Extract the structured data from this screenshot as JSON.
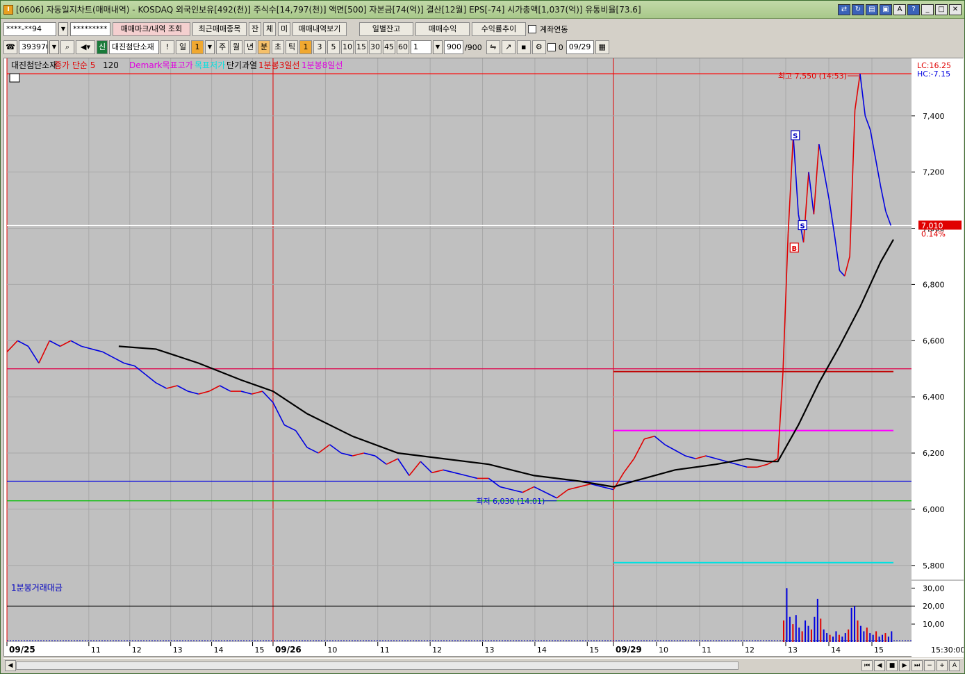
{
  "window": {
    "title": "[0606] 자동일지차트(매매내역) - KOSDAQ 외국인보유[492(천)] 주식수[14,797(천)] 액면[500] 자본금[74(억)] 결산[12월] EPS[-74] 시가총액[1,037(억)] 유통비율[73.6]"
  },
  "toolbar1": {
    "account": "****-**94",
    "password": "*********",
    "trade_mark_button": "매매마크/내역 조회",
    "recent_button": "최근매매종목",
    "jan_button": "잔",
    "che_button": "체",
    "mi_button": "미",
    "history_button": "매매내역보기",
    "daily_balance_button": "일별잔고",
    "profit_button": "매매수익",
    "return_button": "수익률추이",
    "link_label": "계좌연동"
  },
  "toolbar2": {
    "code": "393970",
    "new_badge": "신",
    "stock_name": "대진첨단소재",
    "exclaim": "!",
    "period_day": "일",
    "period_day_value": "1",
    "period_week": "주",
    "period_month": "월",
    "period_year": "년",
    "period_min": "분",
    "period_sec": "초",
    "period_tick": "틱",
    "intervals": [
      "1",
      "3",
      "5",
      "10",
      "15",
      "30",
      "45",
      "60"
    ],
    "interval_value": "1",
    "count_value": "900",
    "count_total": "/900",
    "date_value": "09/29",
    "checkbox_label": "0"
  },
  "legend": [
    {
      "text": "대진첨단소재",
      "color": "#000000"
    },
    {
      "text": "종가 단순 5",
      "color": "#e00000"
    },
    {
      "text": "120",
      "color": "#000000"
    },
    {
      "text": "Demark목표고가",
      "color": "#e000e0"
    },
    {
      "text": "목표저가",
      "color": "#00e0e0"
    },
    {
      "text": "단기과열",
      "color": "#000000"
    },
    {
      "text": "1분봉3일선",
      "color": "#e00000"
    },
    {
      "text": "1분봉8일선",
      "color": "#e000e0"
    }
  ],
  "lc_label": "LC:16.25",
  "hc_label": "HC:-7.15",
  "current_price_label": "7,010",
  "current_pct_label": "0.14%",
  "high_annotation": "최고 7,550 (14:53)",
  "low_annotation": "최저 6,030 (14:01)",
  "volume_label": "1분봉거래대금",
  "marks": {
    "s1": "S",
    "s2": "S",
    "b1": "B"
  },
  "time_end_label": "15:30:00",
  "colors": {
    "plot_bg": "#c0c0c0",
    "up": "#e00000",
    "down": "#0000e0",
    "ma120": "#000000",
    "hline_red": "#ff0000",
    "hline_crimson": "#e0004a",
    "hline_blue": "#0000e0",
    "hline_green": "#00c000",
    "hline_magenta": "#ff00ff",
    "hline_cyan": "#00e0e0"
  },
  "chart_data": {
    "type": "line",
    "title": "",
    "subtitle": "",
    "xlabel": "",
    "ylabel": "",
    "ylim": [
      5750,
      7580
    ],
    "y_ticks": [
      5800,
      6000,
      6200,
      6400,
      6600,
      6800,
      7000,
      7200,
      7400
    ],
    "y_tick_labels": [
      "5,800",
      "6,000",
      "6,200",
      "6,400",
      "6,600",
      "6,800",
      "7,000",
      "7,200",
      "7,400"
    ],
    "x_tick_labels": [
      {
        "label": "09/25",
        "day": 0,
        "hour": 9
      },
      {
        "label": "11",
        "day": 0,
        "hour": 11
      },
      {
        "label": "12",
        "day": 0,
        "hour": 12
      },
      {
        "label": "13",
        "day": 0,
        "hour": 13
      },
      {
        "label": "14",
        "day": 0,
        "hour": 14
      },
      {
        "label": "15",
        "day": 0,
        "hour": 15
      },
      {
        "label": "09/26",
        "day": 1,
        "hour": 9
      },
      {
        "label": "10",
        "day": 1,
        "hour": 10
      },
      {
        "label": "11",
        "day": 1,
        "hour": 11
      },
      {
        "label": "12",
        "day": 1,
        "hour": 12
      },
      {
        "label": "13",
        "day": 1,
        "hour": 13
      },
      {
        "label": "14",
        "day": 1,
        "hour": 14
      },
      {
        "label": "15",
        "day": 1,
        "hour": 15
      },
      {
        "label": "09/29",
        "day": 2,
        "hour": 9
      },
      {
        "label": "10",
        "day": 2,
        "hour": 10
      },
      {
        "label": "11",
        "day": 2,
        "hour": 11
      },
      {
        "label": "12",
        "day": 2,
        "hour": 12
      },
      {
        "label": "13",
        "day": 2,
        "hour": 13
      },
      {
        "label": "14",
        "day": 2,
        "hour": 14
      },
      {
        "label": "15",
        "day": 2,
        "hour": 15
      }
    ],
    "price_series": {
      "name": "대진첨단소재",
      "points": [
        [
          0,
          6560
        ],
        [
          0.02,
          6600
        ],
        [
          0.04,
          6580
        ],
        [
          0.06,
          6520
        ],
        [
          0.08,
          6600
        ],
        [
          0.1,
          6580
        ],
        [
          0.12,
          6600
        ],
        [
          0.14,
          6580
        ],
        [
          0.16,
          6570
        ],
        [
          0.18,
          6560
        ],
        [
          0.2,
          6540
        ],
        [
          0.22,
          6520
        ],
        [
          0.24,
          6510
        ],
        [
          0.26,
          6480
        ],
        [
          0.28,
          6450
        ],
        [
          0.3,
          6430
        ],
        [
          0.32,
          6440
        ],
        [
          0.34,
          6420
        ],
        [
          0.36,
          6410
        ],
        [
          0.38,
          6420
        ],
        [
          0.4,
          6440
        ],
        [
          0.42,
          6420
        ],
        [
          0.44,
          6420
        ],
        [
          0.46,
          6410
        ],
        [
          0.48,
          6420
        ],
        [
          0.5,
          6380
        ],
        [
          0.52,
          6300
        ],
        [
          0.54,
          6280
        ],
        [
          0.56,
          6220
        ],
        [
          0.58,
          6200
        ],
        [
          0.6,
          6230
        ],
        [
          0.62,
          6200
        ],
        [
          0.64,
          6190
        ],
        [
          0.66,
          6200
        ],
        [
          0.68,
          6190
        ],
        [
          0.7,
          6160
        ],
        [
          0.72,
          6180
        ],
        [
          0.74,
          6120
        ],
        [
          0.76,
          6170
        ],
        [
          0.78,
          6130
        ],
        [
          0.8,
          6140
        ],
        [
          0.82,
          6130
        ],
        [
          0.84,
          6120
        ],
        [
          0.86,
          6110
        ],
        [
          0.88,
          6110
        ],
        [
          0.9,
          6080
        ],
        [
          0.92,
          6070
        ],
        [
          0.94,
          6060
        ],
        [
          0.96,
          6080
        ],
        [
          0.98,
          6060
        ],
        [
          1.0,
          6040
        ],
        [
          1.02,
          6070
        ],
        [
          1.04,
          6080
        ],
        [
          1.06,
          6090
        ],
        [
          1.08,
          6080
        ],
        [
          1.1,
          6070
        ],
        [
          1.12,
          6130
        ],
        [
          1.14,
          6180
        ],
        [
          1.16,
          6250
        ],
        [
          1.18,
          6260
        ],
        [
          1.2,
          6230
        ],
        [
          1.22,
          6210
        ],
        [
          1.24,
          6190
        ],
        [
          1.26,
          6180
        ],
        [
          1.28,
          6190
        ],
        [
          1.3,
          6180
        ],
        [
          1.32,
          6170
        ],
        [
          1.34,
          6160
        ],
        [
          1.36,
          6150
        ],
        [
          1.38,
          6150
        ],
        [
          1.4,
          6160
        ],
        [
          1.42,
          6180
        ],
        [
          1.43,
          6490
        ],
        [
          1.44,
          6980
        ],
        [
          1.45,
          7330
        ],
        [
          1.46,
          7050
        ],
        [
          1.47,
          6950
        ],
        [
          1.48,
          7200
        ],
        [
          1.49,
          7050
        ],
        [
          1.5,
          7300
        ],
        [
          1.51,
          7200
        ],
        [
          1.52,
          7100
        ],
        [
          1.53,
          6980
        ],
        [
          1.54,
          6850
        ],
        [
          1.55,
          6830
        ],
        [
          1.56,
          6900
        ],
        [
          1.57,
          7420
        ],
        [
          1.58,
          7550
        ],
        [
          1.59,
          7400
        ],
        [
          1.6,
          7350
        ],
        [
          1.61,
          7250
        ],
        [
          1.62,
          7150
        ],
        [
          1.63,
          7060
        ],
        [
          1.64,
          7010
        ]
      ]
    },
    "ma120_series": {
      "name": "120",
      "points": [
        [
          0.21,
          6580
        ],
        [
          0.28,
          6570
        ],
        [
          0.36,
          6520
        ],
        [
          0.44,
          6460
        ],
        [
          0.5,
          6420
        ],
        [
          0.56,
          6340
        ],
        [
          0.64,
          6260
        ],
        [
          0.72,
          6200
        ],
        [
          0.8,
          6180
        ],
        [
          0.88,
          6160
        ],
        [
          0.96,
          6120
        ],
        [
          1.04,
          6100
        ],
        [
          1.1,
          6080
        ],
        [
          1.16,
          6110
        ],
        [
          1.22,
          6140
        ],
        [
          1.3,
          6160
        ],
        [
          1.36,
          6180
        ],
        [
          1.4,
          6170
        ],
        [
          1.42,
          6170
        ],
        [
          1.46,
          6300
        ],
        [
          1.5,
          6450
        ],
        [
          1.54,
          6580
        ],
        [
          1.58,
          6720
        ],
        [
          1.62,
          6880
        ],
        [
          1.645,
          6960
        ]
      ]
    },
    "horizontal_lines": [
      {
        "value": 7550,
        "color": "#ff0000",
        "from": 0,
        "to": 1
      },
      {
        "value": 7010,
        "color": "#ffffff",
        "from": 0,
        "to": 1
      },
      {
        "value": 6500,
        "color": "#e0004a",
        "from": 0,
        "to": 1
      },
      {
        "value": 6490,
        "color": "#c00000",
        "from": 1.1,
        "to": 1.645
      },
      {
        "value": 6280,
        "color": "#ff00ff",
        "from": 1.1,
        "to": 1.645
      },
      {
        "value": 6100,
        "color": "#0000e0",
        "from": 0,
        "to": 1
      },
      {
        "value": 6030,
        "color": "#00c000",
        "from": 0,
        "to": 1
      },
      {
        "value": 5810,
        "color": "#00e0e0",
        "from": 1.1,
        "to": 1.645
      }
    ],
    "volume": {
      "label": "1분봉거래대금",
      "y_ticks": [
        10,
        20,
        30
      ],
      "y_tick_labels": [
        "10,00",
        "20,00",
        "30,00"
      ],
      "ylim": [
        0,
        34
      ],
      "ref_line": 20,
      "bars": [
        [
          1.43,
          12
        ],
        [
          1.436,
          30
        ],
        [
          1.442,
          14
        ],
        [
          1.448,
          10
        ],
        [
          1.454,
          15
        ],
        [
          1.46,
          8
        ],
        [
          1.466,
          6
        ],
        [
          1.472,
          12
        ],
        [
          1.478,
          9
        ],
        [
          1.484,
          7
        ],
        [
          1.49,
          14
        ],
        [
          1.496,
          24
        ],
        [
          1.502,
          13
        ],
        [
          1.508,
          7
        ],
        [
          1.514,
          5
        ],
        [
          1.52,
          4
        ],
        [
          1.526,
          3
        ],
        [
          1.532,
          6
        ],
        [
          1.538,
          4
        ],
        [
          1.544,
          3
        ],
        [
          1.55,
          5
        ],
        [
          1.556,
          7
        ],
        [
          1.562,
          19
        ],
        [
          1.568,
          20
        ],
        [
          1.574,
          12
        ],
        [
          1.58,
          9
        ],
        [
          1.586,
          6
        ],
        [
          1.592,
          8
        ],
        [
          1.598,
          5
        ],
        [
          1.604,
          4
        ],
        [
          1.61,
          6
        ],
        [
          1.616,
          3
        ],
        [
          1.622,
          4
        ],
        [
          1.628,
          5
        ],
        [
          1.634,
          3
        ],
        [
          1.64,
          6
        ]
      ]
    }
  }
}
